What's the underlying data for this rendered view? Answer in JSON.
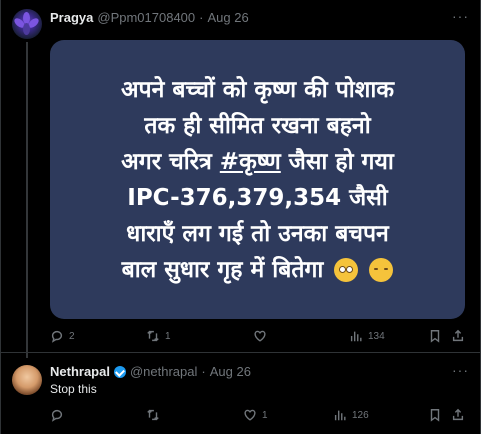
{
  "tweet1": {
    "author_name": "Pragya",
    "handle": "@Ppm01708400",
    "separator": "·",
    "date": "Aug 26",
    "more": "···",
    "image_lines": [
      "अपने बच्चों को कृष्ण की पोशाक",
      "तक ही सीमित रखना बहनो",
      "अगर चरित्र",
      "#कृष्ण",
      "जैसा हो गया",
      "IPC-376,379,354 जैसी",
      "धाराएँ लग गई तो उनका बचपन",
      "बाल सुधार गृह में बितेगा"
    ],
    "emojis": [
      "eye-roll-emoji",
      "smirk-emoji"
    ],
    "replies": "2",
    "reposts": "1",
    "likes": "",
    "views": "134"
  },
  "tweet2": {
    "author_name": "Nethrapal",
    "handle": "@nethrapal",
    "separator": "·",
    "date": "Aug 26",
    "more": "···",
    "text": "Stop this",
    "replies": "",
    "reposts": "",
    "likes": "1",
    "views": "126"
  },
  "colors": {
    "background": "#000000",
    "card": "#2e3a5c",
    "muted": "#71767b",
    "verified": "#1d9bf0"
  }
}
